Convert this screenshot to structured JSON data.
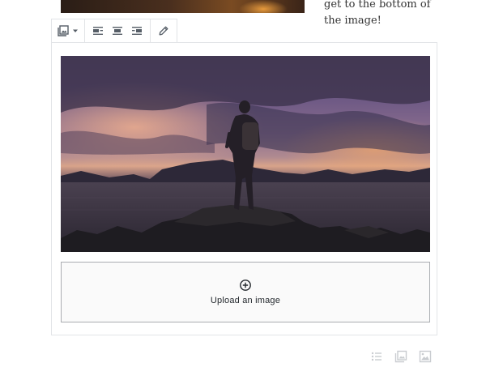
{
  "previous_block": {
    "text_lines": [
      "get to the bottom of",
      "the image!"
    ]
  },
  "toolbar": {
    "block_type_icon": "gallery-icon",
    "dropdown_icon": "caret-down-icon",
    "align_buttons": [
      {
        "icon": "align-left-icon",
        "label": "Align left"
      },
      {
        "icon": "align-center-icon",
        "label": "Align center"
      },
      {
        "icon": "align-right-icon",
        "label": "Align right"
      }
    ],
    "edit_icon": "pencil-icon"
  },
  "gallery": {
    "image_alt": "Person standing on rocks by a lake at dusk under a cloudy purple sky",
    "upload_label": "Upload an image",
    "upload_icon": "plus-circle-icon"
  },
  "inserter_shortcuts": [
    {
      "icon": "list-icon"
    },
    {
      "icon": "gallery-icon"
    },
    {
      "icon": "image-icon"
    }
  ],
  "colors": {
    "border": "#e2e4e7",
    "icon": "#555d66",
    "upload_border": "#a9acb0",
    "faint_icon": "#c9ccd0"
  }
}
